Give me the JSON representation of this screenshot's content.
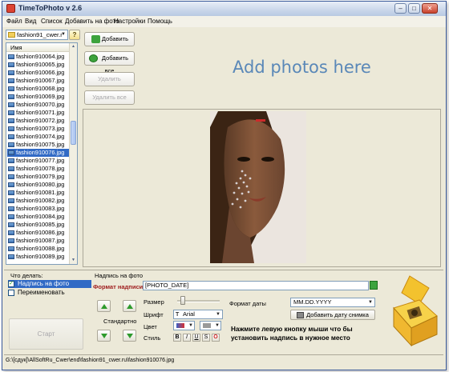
{
  "app": {
    "title": "TimeToPhoto v 2.6"
  },
  "menu": [
    "Файл",
    "Вид",
    "Список",
    "Добавить на фото",
    "Настройки",
    "Помощь"
  ],
  "folder": {
    "value": "fashion91_cwer.r"
  },
  "file_list": {
    "header": "Имя",
    "items": [
      "fashion910064.jpg",
      "fashion910065.jpg",
      "fashion910066.jpg",
      "fashion910067.jpg",
      "fashion910068.jpg",
      "fashion910069.jpg",
      "fashion910070.jpg",
      "fashion910071.jpg",
      "fashion910072.jpg",
      "fashion910073.jpg",
      "fashion910074.jpg",
      "fashion910075.jpg",
      "fashion910076.jpg",
      "fashion910077.jpg",
      "fashion910078.jpg",
      "fashion910079.jpg",
      "fashion910080.jpg",
      "fashion910081.jpg",
      "fashion910082.jpg",
      "fashion910083.jpg",
      "fashion910084.jpg",
      "fashion910085.jpg",
      "fashion910086.jpg",
      "fashion910087.jpg",
      "fashion910088.jpg",
      "fashion910089.jpg"
    ],
    "selected": "fashion910076.jpg"
  },
  "buttons": {
    "add": "Добавить",
    "add_all": "Добавить все",
    "remove": "Удалить",
    "remove_all": "Удалить все",
    "start": "Старт",
    "add_date": "Добавить дату снимка"
  },
  "drop_hint": "Add photos here",
  "actions": {
    "title": "Что делать:",
    "items": [
      {
        "label": "Надпись на фото",
        "checked": true
      },
      {
        "label": "Переименовать",
        "checked": false
      }
    ]
  },
  "caption": {
    "title": "Надпись на фото",
    "format_label": "Формат надписи",
    "format_value": "[PHOTO_DATE]",
    "position_label": "Стандартно",
    "size_label": "Размер",
    "font_label": "Шрифт",
    "font_value": "Arial",
    "font_icon": "T",
    "color_label": "Цвет",
    "style_label": "Стиль",
    "style_buttons": [
      "B",
      "I",
      "U",
      "S",
      "O"
    ],
    "date_format_label": "Формат даты",
    "date_format_value": "MM.DD.YYYY",
    "hint": "Нажмите левую кнопку мыши что бы установить надпись в нужное место"
  },
  "status_path": "G:\\[сдук]\\AllSoftRu_Cwer\\end\\fashion91_cwer.ru\\fashion910076.jpg",
  "colors": {
    "selection": "#316ac5",
    "accent_text": "#5a88b8",
    "green": "#3da33d"
  },
  "icons": [
    "app-icon",
    "folder-icon",
    "help-icon",
    "file-icon",
    "add-arrow-icon",
    "add-all-icon",
    "scroll-up-icon",
    "scroll-down-icon",
    "go-icon",
    "arrow-up-icon",
    "arrow-down-icon",
    "font-icon",
    "color-icon",
    "bg-color-icon",
    "camera-icon",
    "logo-icon"
  ]
}
